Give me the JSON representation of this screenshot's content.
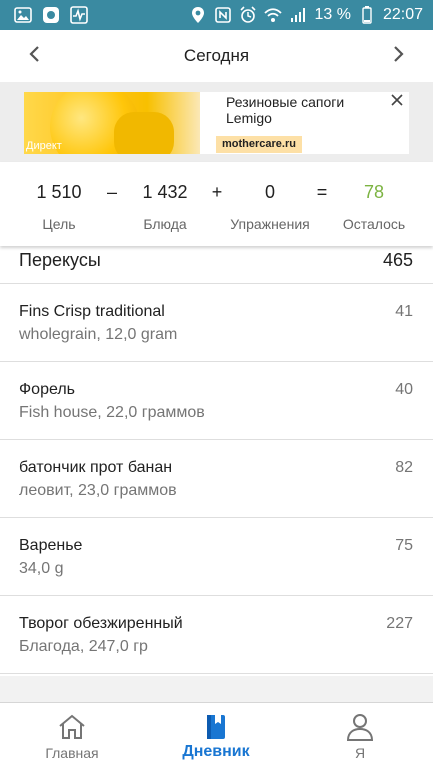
{
  "status_bar": {
    "battery_percent": "13 %",
    "time": "22:07",
    "left_icons": [
      "gallery-icon",
      "app-notification-icon",
      "activity-icon"
    ],
    "right_icons": [
      "location-icon",
      "nfc-icon",
      "alarm-icon",
      "wifi-icon",
      "signal-icon",
      "battery-icon"
    ]
  },
  "header": {
    "title": "Сегодня",
    "prev_icon": "chevron-left-icon",
    "next_icon": "chevron-right-icon"
  },
  "ad": {
    "label": "Директ",
    "title": "Резиновые сапоги Lemigo",
    "domain": "mothercare.ru",
    "close_icon": "close-icon"
  },
  "summary": {
    "goal_value": "1 510",
    "goal_label": "Цель",
    "minus": "–",
    "food_value": "1 432",
    "food_label": "Блюда",
    "plus": "+",
    "exercise_value": "0",
    "exercise_label": "Упражнения",
    "equals": "=",
    "remaining_value": "78",
    "remaining_label": "Осталось",
    "remaining_color": "#7cb342"
  },
  "section": {
    "name": "Перекусы",
    "total": "465"
  },
  "entries": [
    {
      "name": "Fins Crisp traditional",
      "desc": "wholegrain, 12,0 gram",
      "cal": "41"
    },
    {
      "name": "Форель",
      "desc": "Fish house, 22,0 граммов",
      "cal": "40"
    },
    {
      "name": "батончик прот банан",
      "desc": "леовит, 23,0 граммов",
      "cal": "82"
    },
    {
      "name": "Варенье",
      "desc": "34,0 g",
      "cal": "75"
    },
    {
      "name": "Творог обезжиренный",
      "desc": "Благода, 247,0 гр",
      "cal": "227"
    }
  ],
  "bottom_nav": {
    "home_label": "Главная",
    "diary_label": "Дневник",
    "me_label": "Я",
    "active_color": "#1976d2"
  }
}
